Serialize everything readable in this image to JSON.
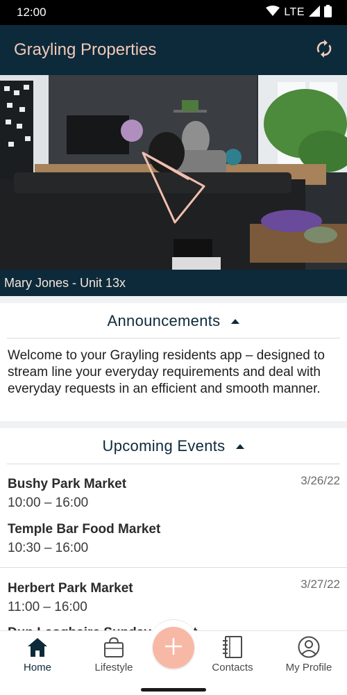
{
  "status_bar": {
    "time": "12:00",
    "network": "LTE"
  },
  "app_bar": {
    "title": "Grayling Properties"
  },
  "hero": {
    "resident_label": "Mary Jones - Unit 13x"
  },
  "announcements": {
    "title": "Announcements",
    "body": "Welcome to your Grayling residents app – designed to stream line your everyday requirements and deal with everyday requests in an efficient and smooth manner."
  },
  "events": {
    "title": "Upcoming Events",
    "groups": [
      {
        "date": "3/26/22",
        "items": [
          {
            "name": "Bushy Park Market",
            "time": "10:00 – 16:00"
          },
          {
            "name": "Temple Bar Food Market",
            "time": "10:30 – 16:00"
          }
        ]
      },
      {
        "date": "3/27/22",
        "items": [
          {
            "name": "Herbert Park Market",
            "time": "11:00 – 16:00"
          },
          {
            "name": "Dun Laoghaire Sunday Market",
            "time": ""
          }
        ]
      }
    ]
  },
  "bottom_nav": {
    "items": [
      {
        "label": "Home",
        "icon": "home-icon"
      },
      {
        "label": "Lifestyle",
        "icon": "shopping-bag-icon"
      },
      {
        "label": "Contacts",
        "icon": "notebook-icon"
      },
      {
        "label": "My Profile",
        "icon": "profile-icon"
      }
    ],
    "fab_icon": "plus-icon"
  },
  "colors": {
    "primary": "#0c2a3a",
    "accent": "#f7b9a6",
    "title_text": "#f2c9b8"
  }
}
